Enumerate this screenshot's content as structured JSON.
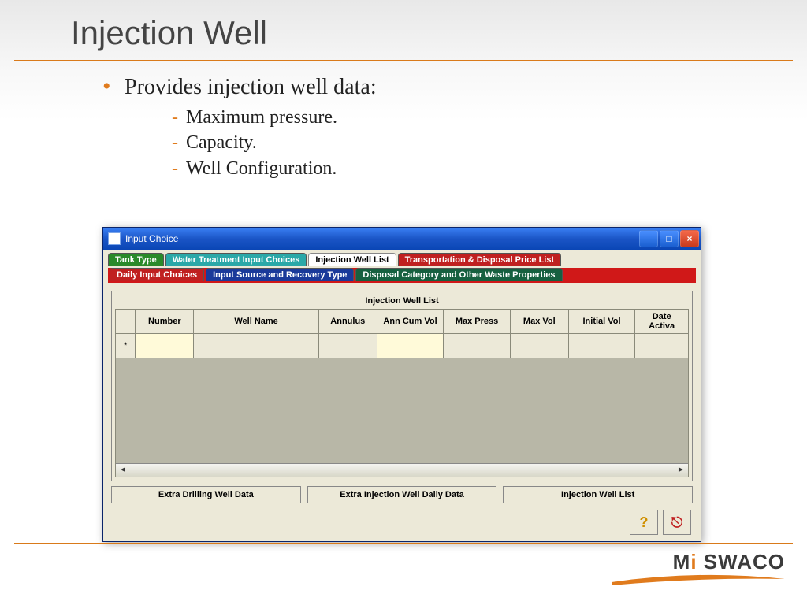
{
  "slide": {
    "title": "Injection Well",
    "bullet": "Provides injection well data:",
    "sub": [
      "Maximum pressure.",
      "Capacity.",
      "Well Configuration."
    ]
  },
  "window": {
    "title": "Input Choice",
    "controls": {
      "min": "_",
      "max": "□",
      "close": "×"
    },
    "tabs_row1": [
      {
        "label": "Tank Type",
        "cls": "green"
      },
      {
        "label": "Water Treatment Input Choices",
        "cls": "teal"
      },
      {
        "label": "Injection Well List",
        "cls": "white"
      },
      {
        "label": "Transportation & Disposal Price List",
        "cls": "redtab"
      }
    ],
    "tabs_row2": [
      {
        "label": "Daily Input Choices",
        "cls": "redtab"
      },
      {
        "label": "Input Source and Recovery Type",
        "cls": "navy"
      },
      {
        "label": "Disposal Category and Other Waste Properties",
        "cls": "dgreen"
      }
    ],
    "grid_caption": "Injection Well List",
    "columns": [
      "Number",
      "Well Name",
      "Annulus",
      "Ann Cum Vol",
      "Max Press",
      "Max Vol",
      "Initial Vol",
      "Date Activa"
    ],
    "row_marker": "*",
    "buttons": [
      "Extra Drilling Well Data",
      "Extra Injection Well Daily Data",
      "Injection Well List"
    ],
    "help_icon": "?",
    "exit_icon": "⎋"
  },
  "brand": {
    "name_prefix": "M",
    "name_accent": "i",
    "name_suffix": " SWACO"
  }
}
